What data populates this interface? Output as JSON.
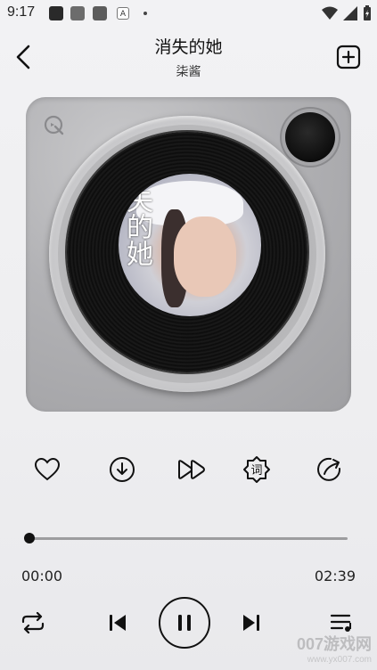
{
  "status_bar": {
    "time": "9:17",
    "notif_badge": "A"
  },
  "header": {
    "title": "消失的她",
    "artist": "柒酱"
  },
  "cover": {
    "text": "失的她"
  },
  "actions": [
    {
      "name": "favorite-button",
      "icon": "heart-icon"
    },
    {
      "name": "download-button",
      "icon": "download-icon"
    },
    {
      "name": "speed-button",
      "icon": "fast-forward-icon"
    },
    {
      "name": "lyrics-button",
      "icon": "lyrics-icon",
      "label": "词"
    },
    {
      "name": "share-button",
      "icon": "share-icon"
    }
  ],
  "playback": {
    "current_time": "00:00",
    "total_time": "02:39",
    "progress": 0.0
  },
  "controls": {
    "repeat": "repeat-icon",
    "previous": "previous-icon",
    "play_pause": "pause-icon",
    "next": "next-icon",
    "playlist": "playlist-icon"
  },
  "watermark": {
    "brand": "007游戏网",
    "url": "www.yx007.com"
  }
}
